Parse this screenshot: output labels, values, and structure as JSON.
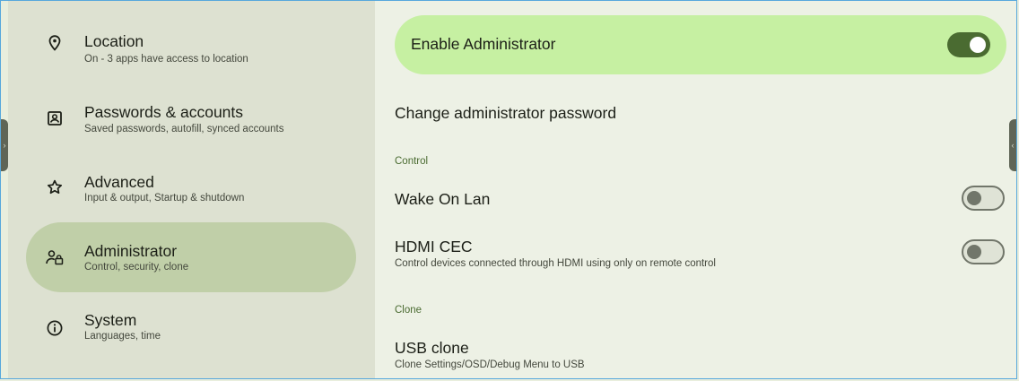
{
  "sidebar": {
    "items": [
      {
        "title": "Location",
        "subtitle": "On - 3 apps have access to location",
        "icon": "location-pin-icon",
        "selected": false
      },
      {
        "title": "Passwords & accounts",
        "subtitle": "Saved passwords, autofill, synced accounts",
        "icon": "account-box-icon",
        "selected": false
      },
      {
        "title": "Advanced",
        "subtitle": "Input & output, Startup & shutdown",
        "icon": "star-outline-icon",
        "selected": false
      },
      {
        "title": "Administrator",
        "subtitle": "Control, security, clone",
        "icon": "admin-lock-icon",
        "selected": true
      },
      {
        "title": "System",
        "subtitle": "Languages, time",
        "icon": "info-icon",
        "selected": false
      }
    ]
  },
  "main": {
    "enable_admin": {
      "label": "Enable Administrator",
      "checked": true
    },
    "change_password": {
      "label": "Change administrator password"
    },
    "control_section": {
      "heading": "Control"
    },
    "wake_on_lan": {
      "label": "Wake On Lan",
      "checked": false
    },
    "hdmi_cec": {
      "label": "HDMI CEC",
      "subtitle": "Control devices connected through HDMI using only on remote control",
      "checked": false
    },
    "clone_section": {
      "heading": "Clone"
    },
    "usb_clone": {
      "label": "USB clone",
      "subtitle": "Clone Settings/OSD/Debug Menu to USB"
    }
  },
  "edge_handles": {
    "left_glyph": "›",
    "right_glyph": "‹"
  },
  "colors": {
    "accent": "#4a6b31",
    "card_highlight": "#c6f0a2",
    "sidebar_selected": "#c0cfa8",
    "sidebar_bg": "#dde1d1",
    "main_bg": "#edf1e5"
  }
}
